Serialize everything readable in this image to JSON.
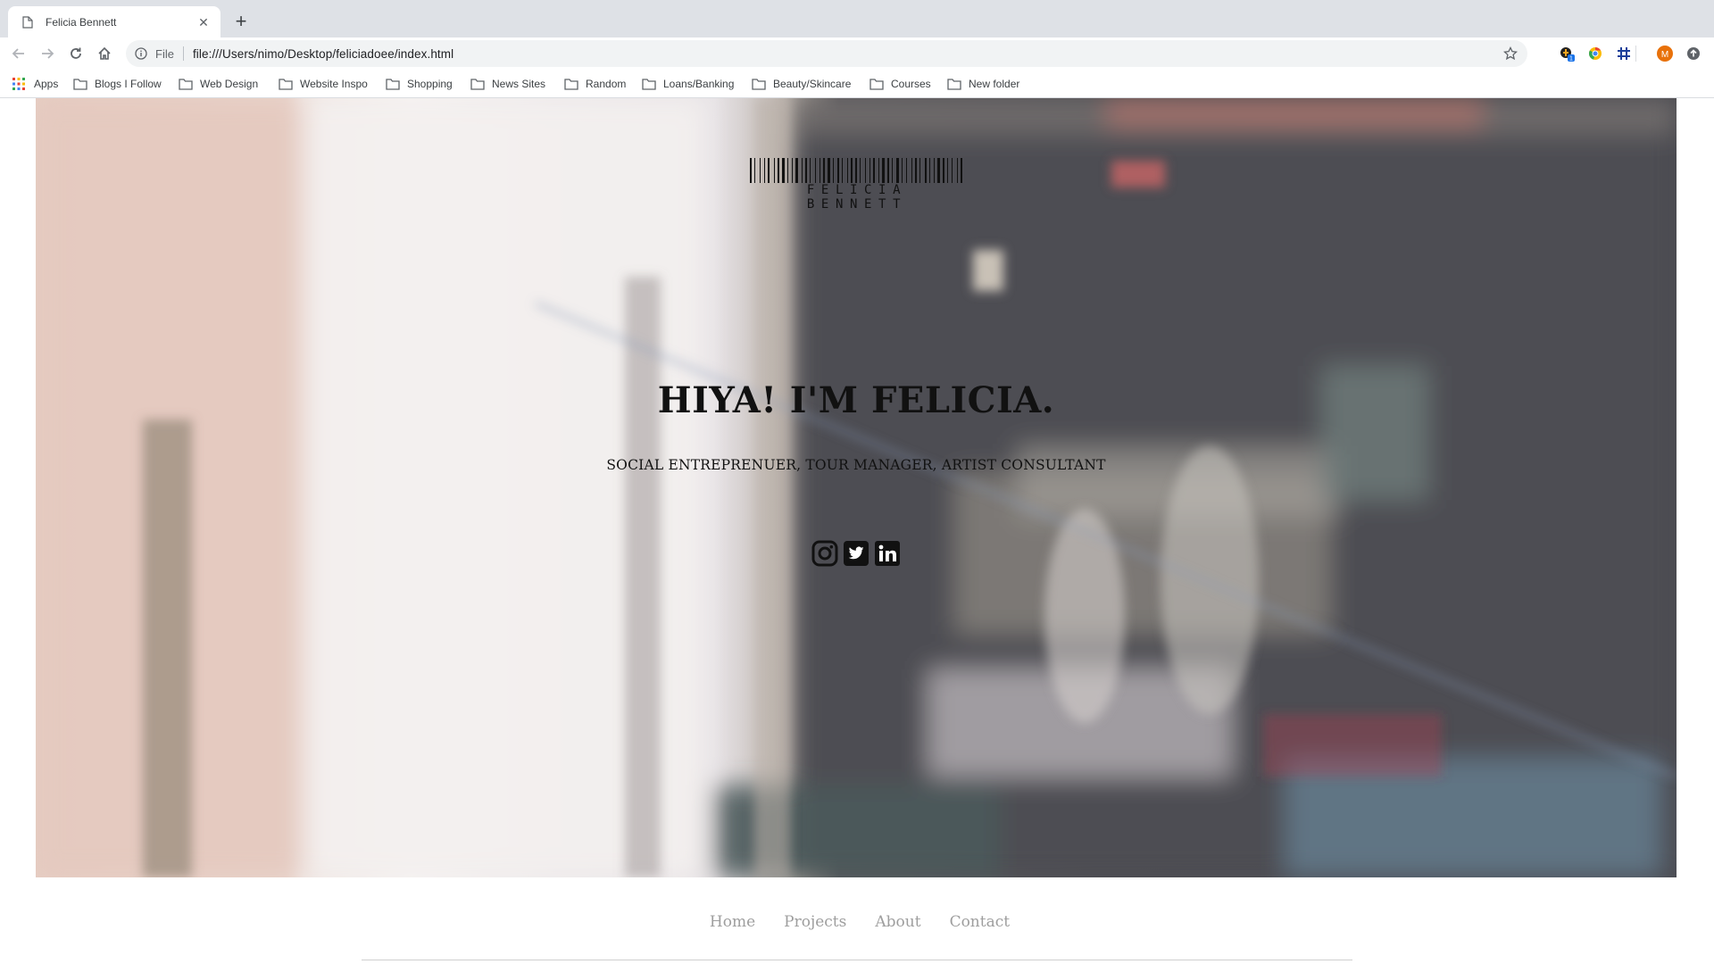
{
  "browser": {
    "tab": {
      "title": "Felicia Bennett",
      "favicon": "page-icon",
      "close_icon": "close-icon"
    },
    "new_tab_icon": "plus-icon",
    "toolbar": {
      "back_icon": "back-arrow-icon",
      "forward_icon": "forward-arrow-icon",
      "reload_icon": "reload-icon",
      "home_icon": "home-icon"
    },
    "omnibox": {
      "scheme_label": "File",
      "url": "file:///Users/nimo/Desktop/feliciadoee/index.html",
      "info_icon": "info-icon",
      "bookmark_icon": "star-icon"
    },
    "extensions": [
      {
        "name": "extension-honey-icon",
        "badge": "1"
      },
      {
        "name": "extension-chrome-icon"
      },
      {
        "name": "extension-hashtag-icon"
      },
      {
        "name": "profile-avatar",
        "label": "M"
      },
      {
        "name": "extension-upload-icon"
      }
    ],
    "bookmarks": [
      {
        "label": "Apps",
        "icon": "apps-grid-icon"
      },
      {
        "label": "Blogs I Follow",
        "icon": "folder-icon"
      },
      {
        "label": "Web Design",
        "icon": "folder-icon"
      },
      {
        "label": "Website Inspo",
        "icon": "folder-icon"
      },
      {
        "label": "Shopping",
        "icon": "folder-icon"
      },
      {
        "label": "News Sites",
        "icon": "folder-icon"
      },
      {
        "label": "Random",
        "icon": "folder-icon"
      },
      {
        "label": "Loans/Banking",
        "icon": "folder-icon"
      },
      {
        "label": "Beauty/Skincare",
        "icon": "folder-icon"
      },
      {
        "label": "Courses",
        "icon": "folder-icon"
      },
      {
        "label": "New folder",
        "icon": "folder-icon"
      }
    ]
  },
  "site": {
    "logo_text": "FELICIA BENNETT",
    "headline": "HIYA! I'M FELICIA.",
    "subheadline": "SOCIAL ENTREPRENUER, TOUR MANAGER, ARTIST CONSULTANT",
    "socials": [
      {
        "name": "instagram-icon"
      },
      {
        "name": "twitter-icon"
      },
      {
        "name": "linkedin-icon"
      }
    ],
    "nav": [
      {
        "label": "Home"
      },
      {
        "label": "Projects"
      },
      {
        "label": "About"
      },
      {
        "label": "Contact"
      }
    ],
    "colors": {
      "text": "#111111",
      "nav_link": "#9e9e9e",
      "avatar": "#e8710a"
    }
  }
}
